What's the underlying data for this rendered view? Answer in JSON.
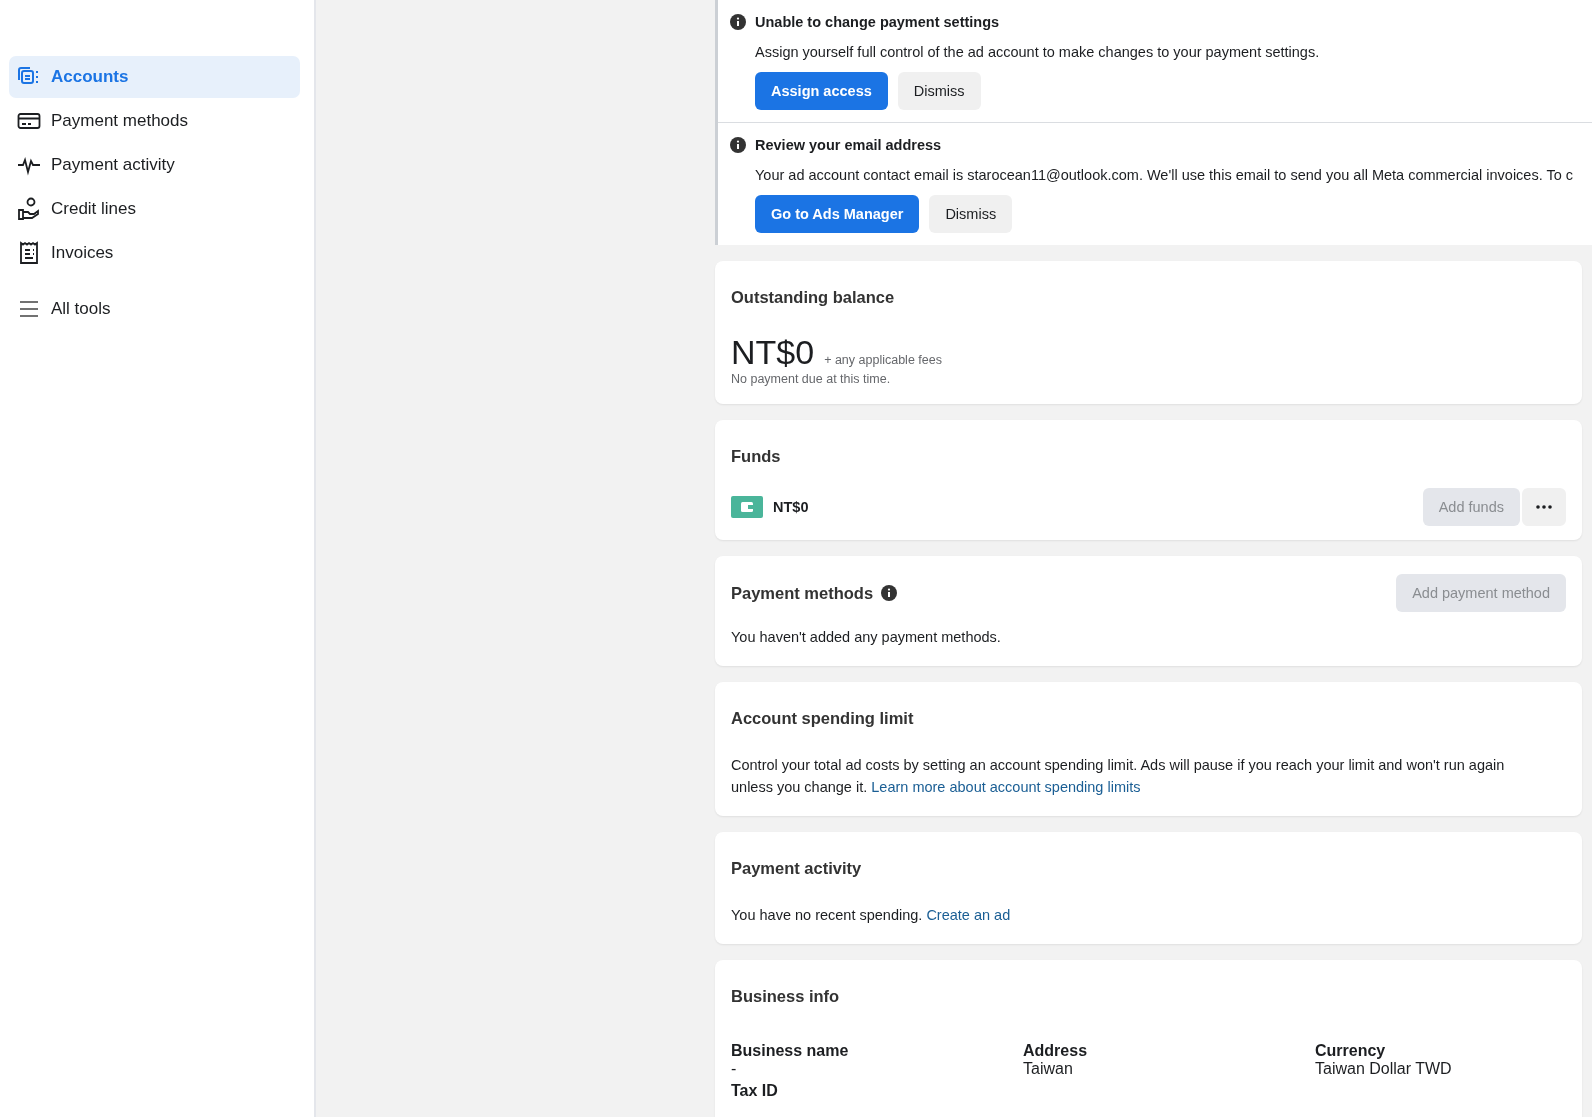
{
  "sidebar": {
    "items": [
      {
        "label": "Accounts",
        "selected": true
      },
      {
        "label": "Payment methods",
        "selected": false
      },
      {
        "label": "Payment activity",
        "selected": false
      },
      {
        "label": "Credit lines",
        "selected": false
      },
      {
        "label": "Invoices",
        "selected": false
      }
    ],
    "tools": {
      "label": "All tools"
    }
  },
  "alerts": [
    {
      "title": "Unable to change payment settings",
      "message": "Assign yourself full control of the ad account to make changes to your payment settings.",
      "buttons": [
        {
          "label": "Assign access",
          "kind": "primary"
        },
        {
          "label": "Dismiss",
          "kind": "secondary"
        }
      ]
    },
    {
      "title": "Review your email address",
      "message": "Your ad account contact email is starocean11@outlook.com. We'll use this email to send you all Meta commercial invoices. To c",
      "buttons": [
        {
          "label": "Go to Ads Manager",
          "kind": "primary"
        },
        {
          "label": "Dismiss",
          "kind": "secondary"
        }
      ]
    }
  ],
  "outstanding_balance": {
    "title": "Outstanding balance",
    "amount": "NT$0",
    "fees_note": "+ any applicable fees",
    "status": "No payment due at this time."
  },
  "funds": {
    "title": "Funds",
    "amount": "NT$0",
    "add_button": {
      "label": "Add funds",
      "disabled": true
    }
  },
  "payment_methods": {
    "title": "Payment methods",
    "add_button": {
      "label": "Add payment method",
      "disabled": true
    },
    "empty_text": "You haven't added any payment methods."
  },
  "spending_limit": {
    "title": "Account spending limit",
    "text": "Control your total ad costs by setting an account spending limit. Ads will pause if you reach your limit and won't run again unless you change it.",
    "link": "Learn more about account spending limits"
  },
  "payment_activity": {
    "title": "Payment activity",
    "text": "You have no recent spending.",
    "link": "Create an ad"
  },
  "business_info": {
    "title": "Business info",
    "fields": [
      {
        "label": "Business name",
        "value": "-"
      },
      {
        "label": "Address",
        "value": "Taiwan"
      },
      {
        "label": "Currency",
        "value": "Taiwan Dollar TWD"
      },
      {
        "label": "Tax ID"
      }
    ]
  }
}
